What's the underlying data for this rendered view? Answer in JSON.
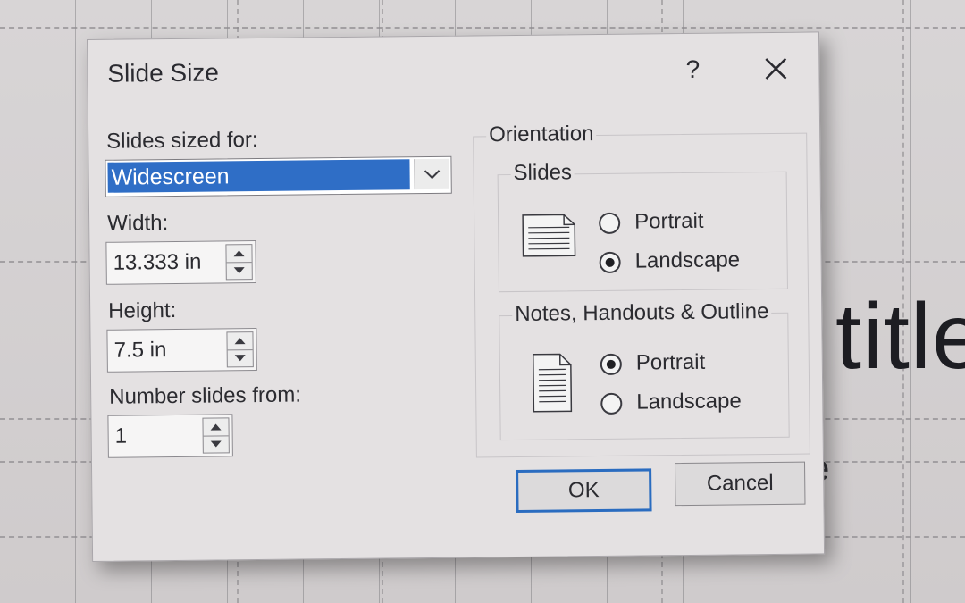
{
  "dialog": {
    "title": "Slide Size",
    "help_label": "?",
    "sized_for": {
      "label": "Slides sized for:",
      "selected": "Widescreen"
    },
    "width": {
      "label": "Width:",
      "value": "13.333 in"
    },
    "height": {
      "label": "Height:",
      "value": "7.5 in"
    },
    "number_from": {
      "label": "Number slides from:",
      "value": "1"
    },
    "orientation": {
      "title": "Orientation",
      "slides": {
        "title": "Slides",
        "options": [
          "Portrait",
          "Landscape"
        ],
        "selected": "Landscape"
      },
      "notes": {
        "title": "Notes, Handouts & Outline",
        "options": [
          "Portrait",
          "Landscape"
        ],
        "selected": "Portrait"
      }
    },
    "buttons": {
      "ok": "OK",
      "cancel": "Cancel"
    }
  },
  "background": {
    "title_fragment": "title",
    "subtitle_fragment": "e"
  },
  "colors": {
    "selection": "#2f6ec6",
    "dialog_bg": "#e4e1e2",
    "default_button_border": "#2a6cc0"
  }
}
